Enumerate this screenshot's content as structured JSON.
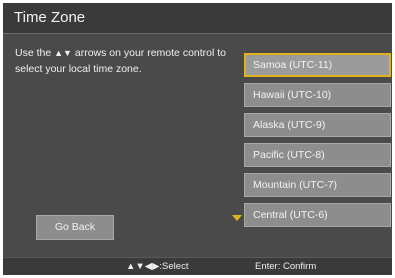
{
  "title": "Time Zone",
  "instruction": {
    "before": "Use the ",
    "arrows": "▲▼",
    "after": " arrows on your remote control to select your local time zone."
  },
  "time_zones": [
    {
      "label": "Samoa (UTC-11)",
      "selected": true
    },
    {
      "label": "Hawaii (UTC-10)",
      "selected": false
    },
    {
      "label": "Alaska (UTC-9)",
      "selected": false
    },
    {
      "label": "Pacific (UTC-8)",
      "selected": false
    },
    {
      "label": "Mountain (UTC-7)",
      "selected": false
    },
    {
      "label": "Central (UTC-6)",
      "selected": false
    }
  ],
  "go_back_label": "Go Back",
  "footer": {
    "select_hint": "▲▼◀▶:Select",
    "enter_hint": "Enter: Confirm"
  },
  "colors": {
    "background": "#4a4a4a",
    "header": "#3a3a3a",
    "item": "#8d8d8d",
    "highlight": "#e0b21c"
  }
}
